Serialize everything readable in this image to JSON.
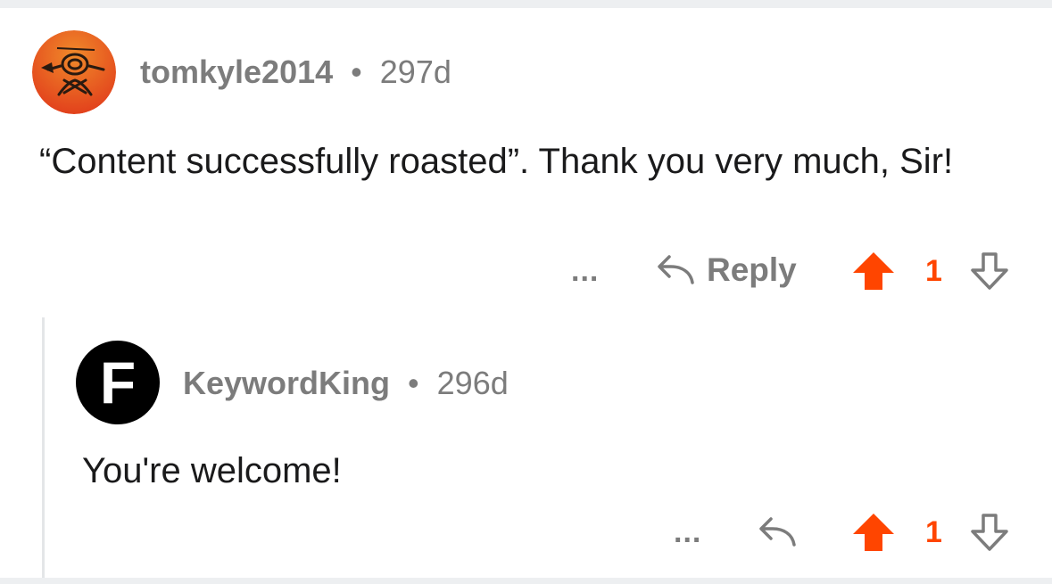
{
  "comments": [
    {
      "username": "tomkyle2014",
      "separator": "•",
      "age": "297d",
      "text": "“Content successfully roasted”. Thank you very much, Sir!",
      "actions": {
        "more": "...",
        "reply_label": "Reply",
        "upvote_count": "1"
      }
    },
    {
      "username": "KeywordKing",
      "avatar_letter": "F",
      "separator": "•",
      "age": "296d",
      "text": "You're welcome!",
      "actions": {
        "more": "...",
        "upvote_count": "1"
      }
    }
  ],
  "colors": {
    "upvote_active": "#ff4500",
    "meta_text": "#7c7c7c",
    "body_text": "#1a1a1b",
    "avatar_2_bg": "#000000"
  },
  "icons": {
    "reply": "reply-arrow-icon",
    "upvote": "upvote-arrow-icon",
    "downvote": "downvote-arrow-icon",
    "more": "more-dots-icon"
  }
}
